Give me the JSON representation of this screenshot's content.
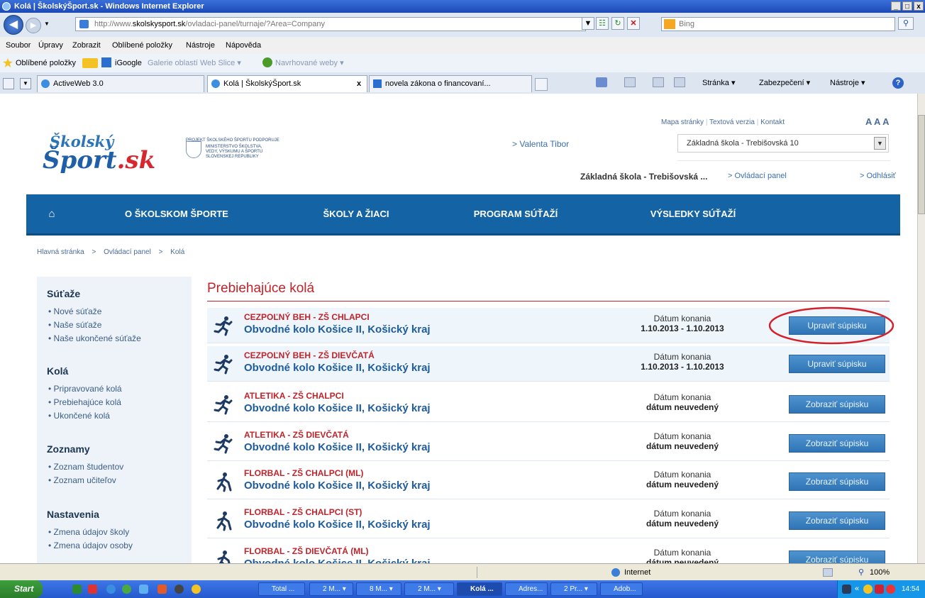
{
  "window": {
    "title": "Kolá | ŠkolskýŠport.sk - Windows Internet Explorer",
    "controls": [
      "_",
      "□",
      "x"
    ]
  },
  "address": {
    "url_prefix": "http://www.",
    "url_domain": "skolskysport.sk",
    "url_rest": "/ovladaci-panel/turnaje/?Area=Company",
    "search_placeholder": "Bing"
  },
  "menu": [
    "Soubor",
    "Úpravy",
    "Zobrazit",
    "Oblíbené položky",
    "Nástroje",
    "Nápověda"
  ],
  "favorites": {
    "label": "Oblíbené položky",
    "items": [
      "iGoogle",
      "Galerie oblastí Web Slice ▾",
      "Navrhované weby ▾"
    ]
  },
  "tabs": [
    {
      "label": "ActiveWeb 3.0"
    },
    {
      "label": "Kolá | ŠkolskýŠport.sk"
    },
    {
      "label": "novela zákona o financovaní..."
    }
  ],
  "tab_close": "x",
  "commandbar": [
    "Stránka ▾",
    "Zabezpečení ▾",
    "Nástroje ▾"
  ],
  "site": {
    "top_links": [
      "Mapa stránky",
      "Textová verzia",
      "Kontakt"
    ],
    "font_sizes": "A A A",
    "logo_top": "Školský",
    "logo_main": "Šport",
    "logo_suffix": ".sk",
    "project_lines": [
      "PROJEKT ŠKOLSKÉHO ŠPORTU PODPORUJE",
      "MINISTERSTVO ŠKOLSTVA,",
      "VEDY, VÝSKUMU A ŠPORTU",
      "SLOVENSKEJ REPUBLIKY"
    ],
    "user_link": "> Valenta Tibor",
    "school_select": "Základná škola - Trebišovská 10",
    "school_short": "Základná škola - Trebišovská ...",
    "panel_link": "> Ovládací panel",
    "logout_link": "> Odhlásiť",
    "nav": [
      "O ŠKOLSKOM ŠPORTE",
      "ŠKOLY A ŽIACI",
      "PROGRAM SÚŤAŽÍ",
      "VÝSLEDKY SÚŤAŽÍ"
    ],
    "breadcrumb": [
      "Hlavná stránka",
      "Ovládací panel",
      "Kolá"
    ],
    "breadcrumb_sep": ">",
    "sidebar": {
      "sections": [
        {
          "title": "Súťaže",
          "links": [
            "Nové súťaže",
            "Naše súťaže",
            "Naše ukončené súťaže"
          ]
        },
        {
          "title": "Kolá",
          "links": [
            "Pripravované kolá",
            "Prebiehajúce kolá",
            "Ukončené kolá"
          ]
        },
        {
          "title": "Zoznamy",
          "links": [
            "Zoznam študentov",
            "Zoznam učiteľov"
          ]
        },
        {
          "title": "Nastavenia",
          "links": [
            "Zmena údajov školy",
            "Zmena údajov osoby"
          ]
        }
      ]
    },
    "page_title": "Prebiehajúce kolá",
    "rows": [
      {
        "title": "CEZPOĽNÝ BEH - ZŠ CHLAPCI",
        "subtitle": "Obvodné kolo Košice II, Košický kraj",
        "date_label": "Dátum konania",
        "date_value": "1.10.2013 - 1.10.2013",
        "button": "Upraviť súpisku"
      },
      {
        "title": "CEZPOĽNÝ BEH - ZŠ DIEVČATÁ",
        "subtitle": "Obvodné kolo Košice II, Košický kraj",
        "date_label": "Dátum konania",
        "date_value": "1.10.2013 - 1.10.2013",
        "button": "Upraviť súpisku"
      },
      {
        "title": "ATLETIKA - ZŠ CHALPCI",
        "subtitle": "Obvodné kolo Košice II, Košický kraj",
        "date_label": "Dátum konania",
        "date_value": "dátum neuvedený",
        "button": "Zobraziť súpisku"
      },
      {
        "title": "ATLETIKA - ZŠ DIEVČATÁ",
        "subtitle": "Obvodné kolo Košice II, Košický kraj",
        "date_label": "Dátum konania",
        "date_value": "dátum neuvedený",
        "button": "Zobraziť súpisku"
      },
      {
        "title": "FLORBAL - ZŠ CHALPCI (ML)",
        "subtitle": "Obvodné kolo Košice II, Košický kraj",
        "date_label": "Dátum konania",
        "date_value": "dátum neuvedený",
        "button": "Zobraziť súpisku"
      },
      {
        "title": "FLORBAL - ZŠ CHALPCI (ST)",
        "subtitle": "Obvodné kolo Košice II, Košický kraj",
        "date_label": "Dátum konania",
        "date_value": "dátum neuvedený",
        "button": "Zobraziť súpisku"
      },
      {
        "title": "FLORBAL - ZŠ DIEVČATÁ (ML)",
        "subtitle": "Obvodné kolo Košice II, Košický kraj",
        "date_label": "Dátum konania",
        "date_value": "dátum neuvedený",
        "button": "Zobraziť súpisku"
      }
    ]
  },
  "status": {
    "zone": "Internet",
    "zoom": "100%"
  },
  "taskbar": {
    "start": "Start",
    "buttons": [
      "Total ...",
      "2 M... ▾",
      "8 M... ▾",
      "2 M... ▾",
      "Kolá ...",
      "Adres...",
      "2 Pr... ▾",
      "Adob..."
    ],
    "clock": "14:54",
    "tray_chevron": "«"
  },
  "colors": {
    "accent": "#1463a5",
    "red": "#c0232a",
    "highlight_circle": "#d4202a"
  }
}
